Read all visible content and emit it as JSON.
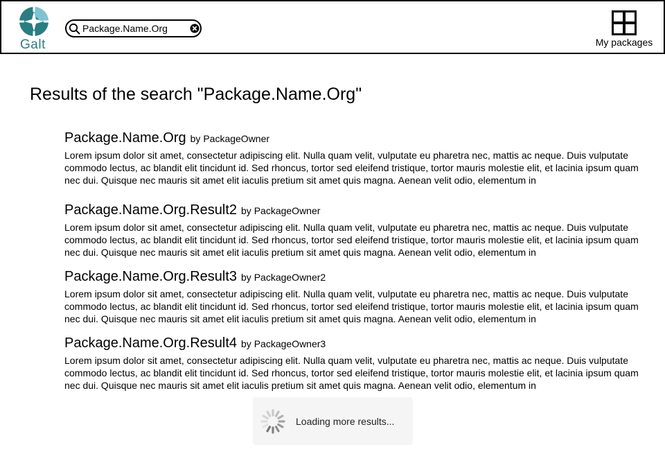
{
  "header": {
    "logo_text": "Galt",
    "search": {
      "value": "Package.Name.Org"
    },
    "my_packages_label": "My packages"
  },
  "page": {
    "title": "Results of the search \"Package.Name.Org\""
  },
  "results": [
    {
      "name": "Package.Name.Org",
      "by_prefix": "by",
      "owner": "PackageOwner",
      "description": "Lorem ipsum dolor sit amet, consectetur adipiscing elit. Nulla quam velit, vulputate eu pharetra nec, mattis ac neque. Duis vulputate commodo lectus, ac blandit elit tincidunt id. Sed rhoncus, tortor sed eleifend tristique, tortor mauris molestie elit, et lacinia ipsum quam nec dui. Quisque nec mauris sit amet elit iaculis pretium sit amet quis magna. Aenean velit odio, elementum in"
    },
    {
      "name": "Package.Name.Org.Result2",
      "by_prefix": "by",
      "owner": "PackageOwner",
      "description": "Lorem ipsum dolor sit amet, consectetur adipiscing elit. Nulla quam velit, vulputate eu pharetra nec, mattis ac neque. Duis vulputate commodo lectus, ac blandit elit tincidunt id. Sed rhoncus, tortor sed eleifend tristique, tortor mauris molestie elit, et lacinia ipsum quam nec dui. Quisque nec mauris sit amet elit iaculis pretium sit amet quis magna. Aenean velit odio, elementum in"
    },
    {
      "name": "Package.Name.Org.Result3",
      "by_prefix": "by",
      "owner": "PackageOwner2",
      "description": "Lorem ipsum dolor sit amet, consectetur adipiscing elit. Nulla quam velit, vulputate eu pharetra nec, mattis ac neque. Duis vulputate commodo lectus, ac blandit elit tincidunt id. Sed rhoncus, tortor sed eleifend tristique, tortor mauris molestie elit, et lacinia ipsum quam nec dui. Quisque nec mauris sit amet elit iaculis pretium sit amet quis magna. Aenean velit odio, elementum in"
    },
    {
      "name": "Package.Name.Org.Result4",
      "by_prefix": "by",
      "owner": "PackageOwner3",
      "description": "Lorem ipsum dolor sit amet, consectetur adipiscing elit. Nulla quam velit, vulputate eu pharetra nec, mattis ac neque. Duis vulputate commodo lectus, ac blandit elit tincidunt id. Sed rhoncus, tortor sed eleifend tristique, tortor mauris molestie elit, et lacinia ipsum quam nec dui. Quisque nec mauris sit amet elit iaculis pretium sit amet quis magna. Aenean velit odio, elementum in"
    }
  ],
  "loading": {
    "text": "Loading more results...",
    "icon": "spinner-icon"
  },
  "icons": {
    "logo": "galt-logo",
    "search": "search-icon",
    "clear": "clear-icon",
    "my_packages": "grid-icon"
  },
  "colors": {
    "logo_teal": "#2a7d82",
    "logo_light": "#7ec3d4",
    "border": "#000000",
    "loading_bg": "#f5f5f5"
  }
}
